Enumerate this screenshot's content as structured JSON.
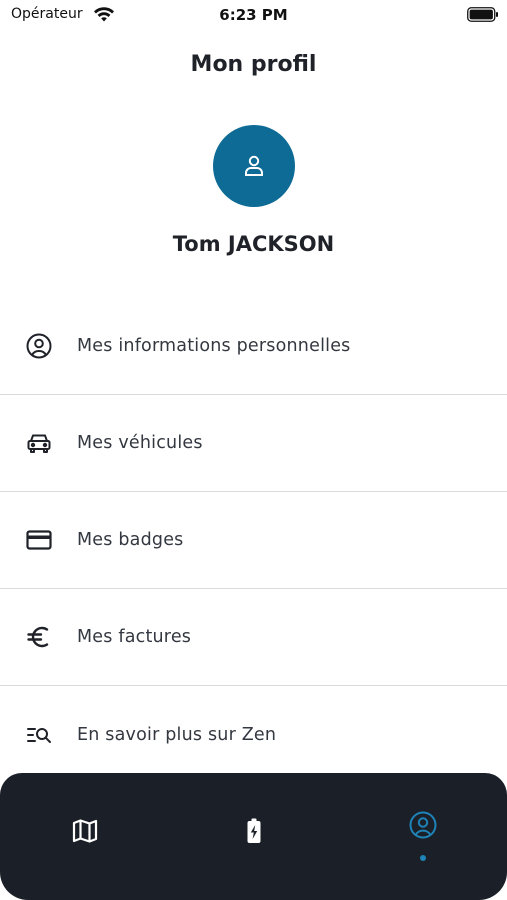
{
  "status_bar": {
    "carrier": "Opérateur",
    "time": "6:23 PM"
  },
  "header": {
    "title": "Mon profil"
  },
  "profile": {
    "name": "Tom JACKSON"
  },
  "menu": {
    "items": [
      {
        "label": "Mes informations personnelles",
        "icon": "user-circle-icon"
      },
      {
        "label": "Mes véhicules",
        "icon": "car-icon"
      },
      {
        "label": "Mes badges",
        "icon": "card-icon"
      },
      {
        "label": "Mes factures",
        "icon": "euro-icon"
      },
      {
        "label": "En savoir plus sur Zen",
        "icon": "list-search-icon"
      }
    ]
  },
  "tab_bar": {
    "tabs": [
      {
        "icon": "map-icon",
        "active": false
      },
      {
        "icon": "battery-charge-icon",
        "active": false
      },
      {
        "icon": "user-circle-icon",
        "active": true
      }
    ]
  },
  "colors": {
    "accent": "#0d6b95",
    "tab_active": "#1e84b8",
    "tab_bar_bg": "#1b1f27",
    "text": "#1f2228"
  }
}
